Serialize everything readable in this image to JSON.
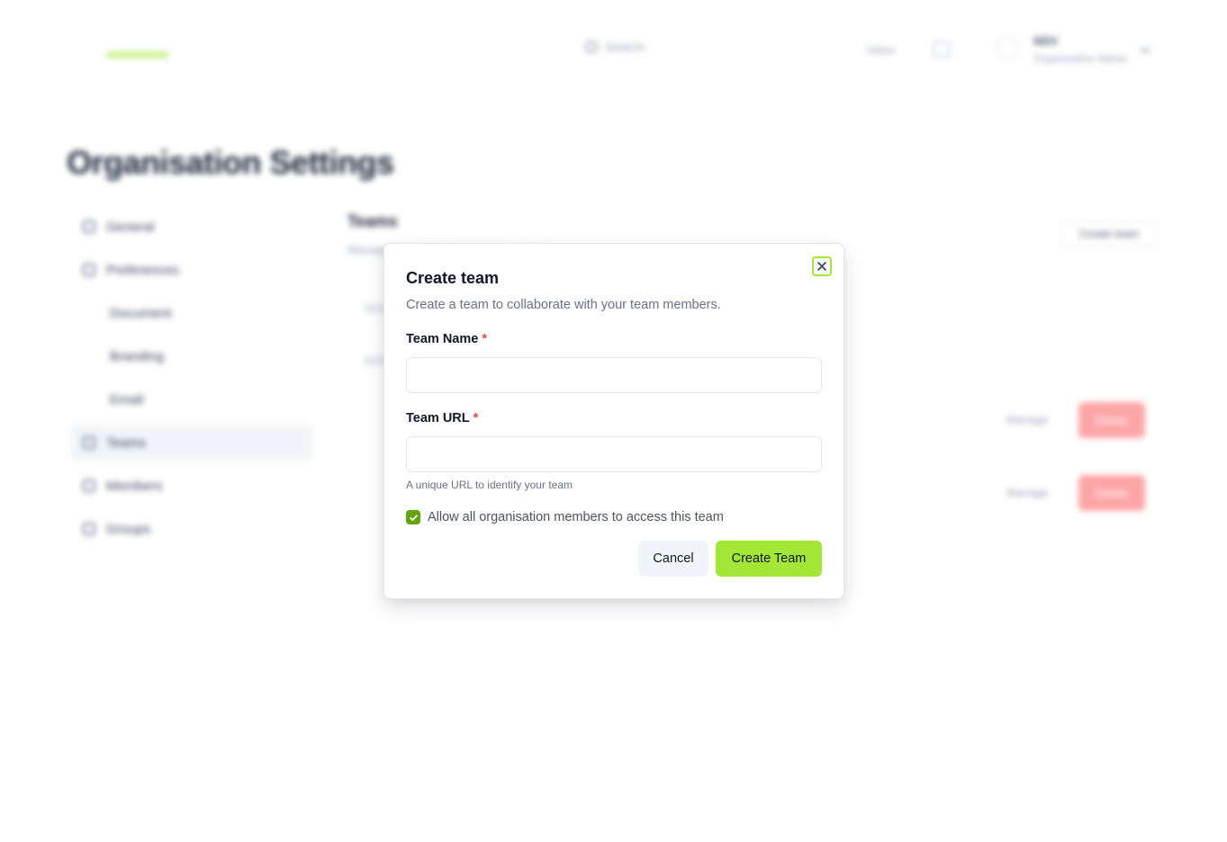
{
  "header": {
    "logo_text": "",
    "search_placeholder": "Search",
    "inbox_label": "Inbox",
    "account_name": "NDV",
    "account_subtitle": "Organisation Admin"
  },
  "page": {
    "title": "Organisation Settings"
  },
  "sidebar": {
    "items": [
      {
        "label": "General",
        "sub": false,
        "active": false
      },
      {
        "label": "Preferences",
        "sub": false,
        "active": false
      },
      {
        "label": "Document",
        "sub": true,
        "active": false
      },
      {
        "label": "Branding",
        "sub": true,
        "active": false
      },
      {
        "label": "Email",
        "sub": true,
        "active": false
      },
      {
        "label": "Teams",
        "sub": false,
        "active": true
      },
      {
        "label": "Members",
        "sub": false,
        "active": false
      },
      {
        "label": "Groups",
        "sub": false,
        "active": false
      }
    ]
  },
  "teams_panel": {
    "heading": "Teams",
    "subheading": "Manage the teams in your organisation.",
    "create_button": "Create team",
    "manage_label": "Manage",
    "delete_label": "Delete"
  },
  "modal": {
    "title": "Create team",
    "description": "Create a team to collaborate with your team members.",
    "team_name_label": "Team Name",
    "team_name_value": "",
    "required_mark": "*",
    "team_url_label": "Team URL",
    "team_url_value": "",
    "team_url_hint": "A unique URL to identify your team",
    "allow_access_label": "Allow all organisation members to access this team",
    "allow_access_checked": true,
    "cancel_label": "Cancel",
    "create_label": "Create Team",
    "colors": {
      "accent": "#a3e635",
      "checkbox": "#65a30d",
      "required": "#ef4444"
    }
  }
}
